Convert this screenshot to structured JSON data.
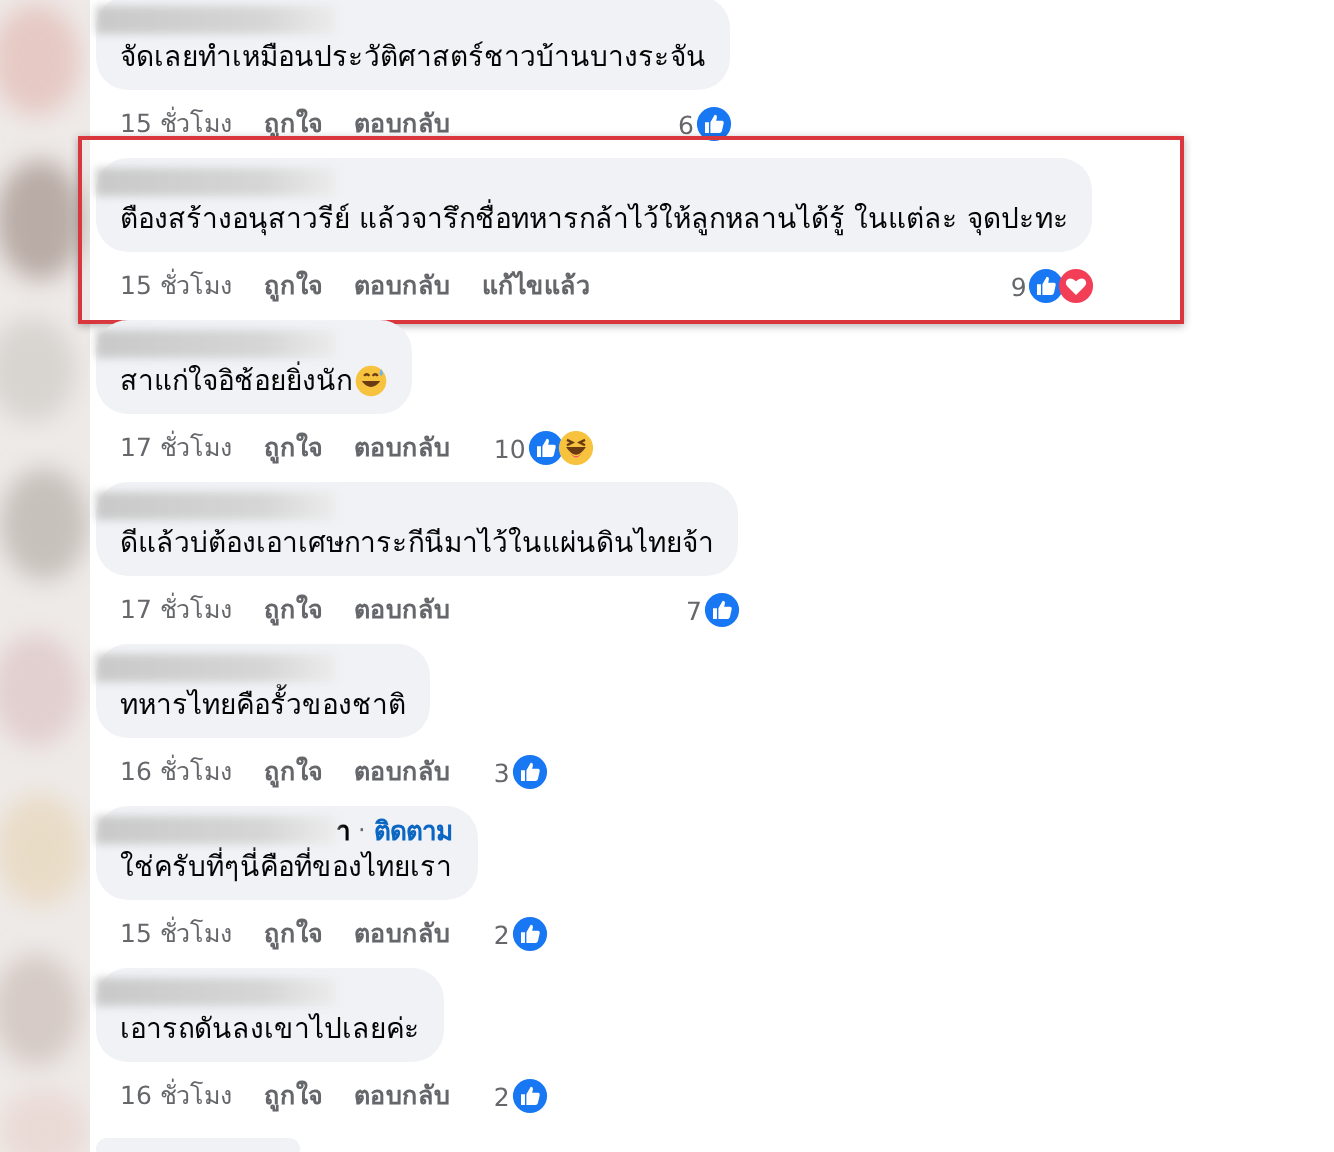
{
  "comments": [
    {
      "text": "จัดเลยทำเหมือนประวัติศาสตร์ชาวบ้านบางระจัน",
      "time": "15 ชั่วโมง",
      "actions": [
        "ถูกใจ",
        "ตอบกลับ"
      ],
      "reaction_count": "6",
      "reactions": [
        {
          "kind": "like"
        }
      ],
      "highlighted": false
    },
    {
      "text": "ตืองสร้างอนุสาวรีย์ แล้วจารึกชื่อทหารกล้าไว้ให้ลูกหลานได้รู้ ในแต่ละ จุดปะทะ",
      "time": "15 ชั่วโมง",
      "actions": [
        "ถูกใจ",
        "ตอบกลับ"
      ],
      "edited_label": "แก้ไขแล้ว",
      "reaction_count": "9",
      "reactions": [
        {
          "kind": "like"
        },
        {
          "kind": "love"
        }
      ],
      "highlighted": true
    },
    {
      "text": "สาแก่ใจอิช้อยยิ่งนัก",
      "text_emoji": {
        "kind": "grin_sweat"
      },
      "time": "17 ชั่วโมง",
      "actions": [
        "ถูกใจ",
        "ตอบกลับ"
      ],
      "reaction_count": "10",
      "reactions": [
        {
          "kind": "like"
        },
        {
          "kind": "haha"
        }
      ],
      "highlighted": false
    },
    {
      "text": "ดีแล้วบ่ต้องเอาเศษการะกีนีมาไว้ในแผ่นดินไทยจ้า",
      "time": "17 ชั่วโมง",
      "actions": [
        "ถูกใจ",
        "ตอบกลับ"
      ],
      "reaction_count": "7",
      "reactions": [
        {
          "kind": "like"
        }
      ],
      "highlighted": false
    },
    {
      "text": "ทหารไทยคือรั้วของชาติ",
      "time": "16 ชั่วโมง",
      "actions": [
        "ถูกใจ",
        "ตอบกลับ"
      ],
      "reaction_count": "3",
      "reactions": [
        {
          "kind": "like"
        }
      ],
      "highlighted": false
    },
    {
      "name_visible": "า",
      "separator": "·",
      "follow_label": "ติดตาม",
      "text": "ใช่ครับที่ๆนี่คือที่ของไทยเรา",
      "time": "15 ชั่วโมง",
      "actions": [
        "ถูกใจ",
        "ตอบกลับ"
      ],
      "reaction_count": "2",
      "reactions": [
        {
          "kind": "like"
        }
      ],
      "highlighted": false
    },
    {
      "text": "เอารถดันลงเขาไปเลยค่ะ",
      "time": "16 ชั่วโมง",
      "actions": [
        "ถูกใจ",
        "ตอบกลับ"
      ],
      "reaction_count": "2",
      "reactions": [
        {
          "kind": "like"
        }
      ],
      "highlighted": false
    }
  ],
  "more_below": true
}
